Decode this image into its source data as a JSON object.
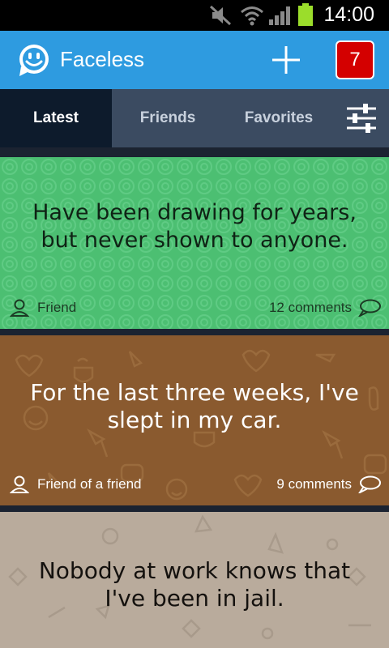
{
  "status_bar": {
    "time": "14:00"
  },
  "app": {
    "title": "Faceless",
    "notification_count": "7"
  },
  "tabs": [
    {
      "label": "Latest",
      "active": true
    },
    {
      "label": "Friends",
      "active": false
    },
    {
      "label": "Favorites",
      "active": false
    }
  ],
  "posts": [
    {
      "text": "Have been drawing for years, but never shown to anyone.",
      "author": "Friend",
      "comments": "12 comments",
      "color": "#4cbf72"
    },
    {
      "text": "For the last three weeks, I've slept in my car.",
      "author": "Friend of a friend",
      "comments": "9 comments",
      "color": "#8a5a2f"
    },
    {
      "text": "Nobody at work knows that I've been in jail.",
      "color": "#b9ab9c"
    }
  ],
  "colors": {
    "app_bar": "#2e9be0",
    "tab_bar": "#3b4b61",
    "tab_active": "#0d1b2c",
    "badge": "#d40000"
  }
}
